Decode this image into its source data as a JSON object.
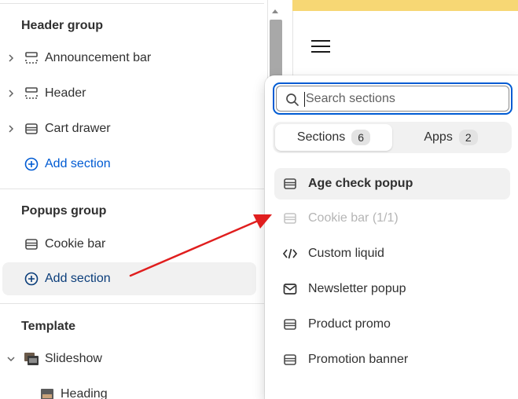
{
  "left_panel": {
    "header_group": {
      "title": "Header group",
      "items": [
        {
          "label": "Announcement bar"
        },
        {
          "label": "Header"
        },
        {
          "label": "Cart drawer"
        }
      ],
      "add_label": "Add section"
    },
    "popups_group": {
      "title": "Popups group",
      "items": [
        {
          "label": "Cookie bar"
        }
      ],
      "add_label": "Add section"
    },
    "template": {
      "title": "Template",
      "items": [
        {
          "label": "Slideshow"
        },
        {
          "label": "Heading"
        }
      ]
    }
  },
  "popover": {
    "search": {
      "placeholder": "Search sections",
      "value": ""
    },
    "tabs": [
      {
        "label": "Sections",
        "count": "6",
        "active": true
      },
      {
        "label": "Apps",
        "count": "2",
        "active": false
      }
    ],
    "sections": [
      {
        "label": "Age check popup",
        "icon": "section-icon",
        "state": "hover"
      },
      {
        "label": "Cookie bar (1/1)",
        "icon": "section-icon",
        "state": "disabled"
      },
      {
        "label": "Custom liquid",
        "icon": "code-icon",
        "state": "normal"
      },
      {
        "label": "Newsletter popup",
        "icon": "email-icon",
        "state": "normal"
      },
      {
        "label": "Product promo",
        "icon": "section-icon",
        "state": "normal"
      },
      {
        "label": "Promotion banner",
        "icon": "section-icon",
        "state": "normal"
      }
    ]
  },
  "colors": {
    "accent": "#005bd3",
    "annotation_arrow": "#e01e1e",
    "announcement_strip": "#f7d774"
  }
}
